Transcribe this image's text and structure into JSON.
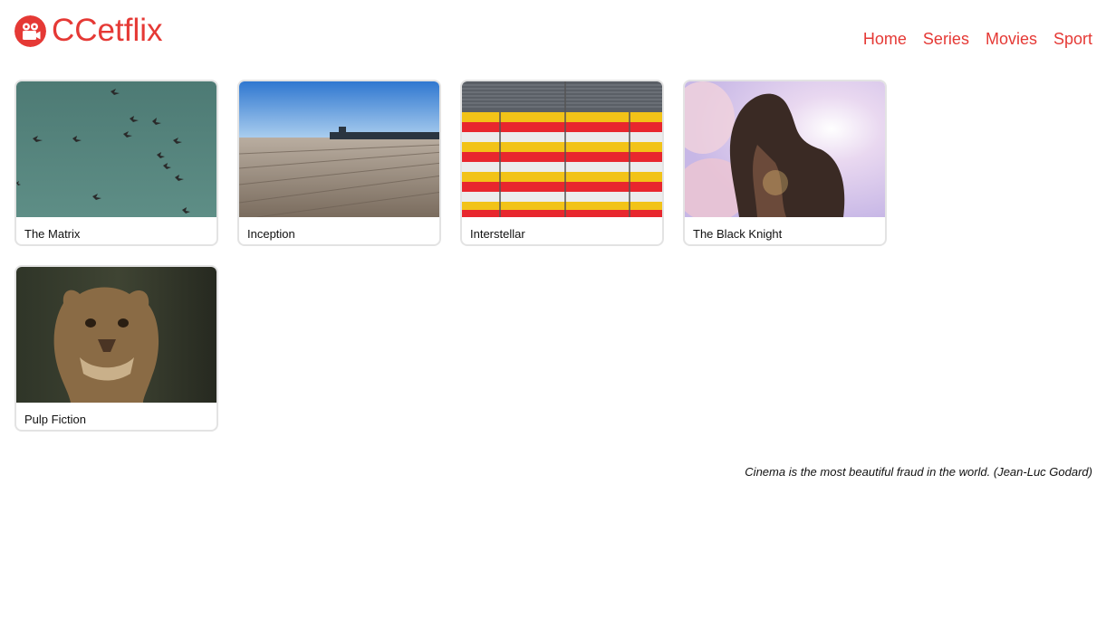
{
  "app": {
    "name": "CCetflix"
  },
  "nav": {
    "items": [
      "Home",
      "Series",
      "Movies",
      "Sport"
    ]
  },
  "movies": [
    {
      "title": "The Matrix",
      "image": "birds-sky"
    },
    {
      "title": "Inception",
      "image": "wooden-pier"
    },
    {
      "title": "Interstellar",
      "image": "striped-wall"
    },
    {
      "title": "The Black Knight",
      "image": "woman-sun"
    },
    {
      "title": "Pulp Fiction",
      "image": "lioness"
    }
  ],
  "footer": {
    "quote": "Cinema is the most beautiful fraud in the world. (Jean-Luc Godard)"
  },
  "colors": {
    "accent": "#e53935",
    "card_border": "#e3e3e3"
  }
}
